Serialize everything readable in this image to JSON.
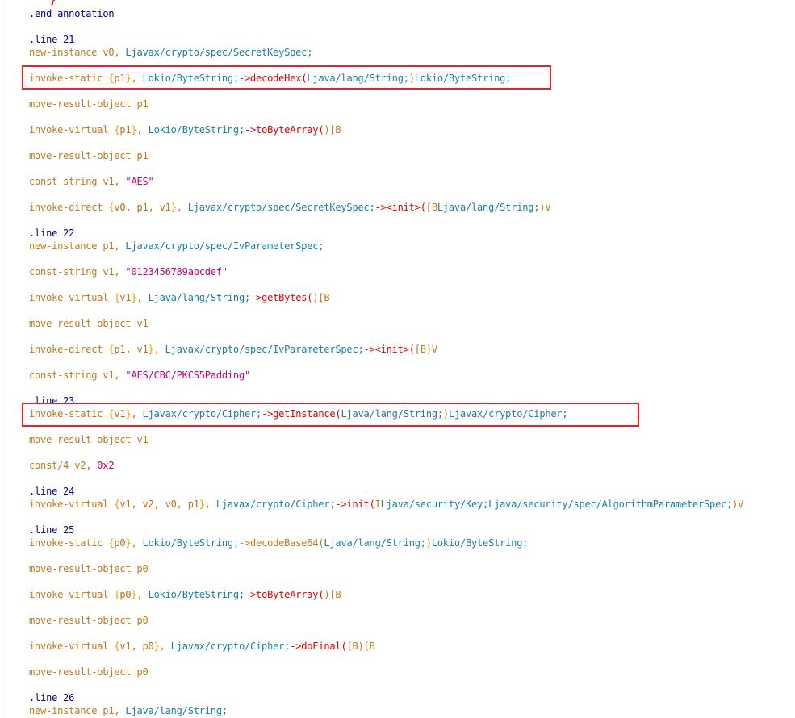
{
  "highlight_color": "#e3242b",
  "lines": {
    "l0": "}",
    "l1": ".end annotation",
    "l2": ".line 21",
    "l3": "new-instance v0, Ljavax/crypto/spec/SecretKeySpec;",
    "l4": "invoke-static {p1}, Lokio/ByteString;->decodeHex(Ljava/lang/String;)Lokio/ByteString;",
    "l5": "move-result-object p1",
    "l6": "invoke-virtual {p1}, Lokio/ByteString;->toByteArray()[B",
    "l7": "move-result-object p1",
    "l8": "const-string v1, \"AES\"",
    "l9": "invoke-direct {v0, p1, v1}, Ljavax/crypto/spec/SecretKeySpec;-><init>([BLjava/lang/String;)V",
    "l10": ".line 22",
    "l11": "new-instance p1, Ljavax/crypto/spec/IvParameterSpec;",
    "l12": "const-string v1, \"0123456789abcdef\"",
    "l13": "invoke-virtual {v1}, Ljava/lang/String;->getBytes()[B",
    "l14": "move-result-object v1",
    "l15": "invoke-direct {p1, v1}, Ljavax/crypto/spec/IvParameterSpec;-><init>([B)V",
    "l16": "const-string v1, \"AES/CBC/PKCS5Padding\"",
    "l17": ".line 23",
    "l18": "invoke-static {v1}, Ljavax/crypto/Cipher;->getInstance(Ljava/lang/String;)Ljavax/crypto/Cipher;",
    "l19": "move-result-object v1",
    "l20": "const/4 v2, 0x2",
    "l21": ".line 24",
    "l22": "invoke-virtual {v1, v2, v0, p1}, Ljavax/crypto/Cipher;->init(ILjava/security/Key;Ljava/security/spec/AlgorithmParameterSpec;)V",
    "l23": ".line 25",
    "l24": "invoke-static {p0}, Lokio/ByteString;->decodeBase64(Ljava/lang/String;)Lokio/ByteString;",
    "l25": "move-result-object p0",
    "l26": "invoke-virtual {p0}, Lokio/ByteString;->toByteArray()[B",
    "l27": "move-result-object p0",
    "l28": "invoke-virtual {v1, p0}, Ljavax/crypto/Cipher;->doFinal([B)[B",
    "l29": "move-result-object p0",
    "l30": ".line 26",
    "l31": "new-instance p1, Ljava/lang/String;"
  }
}
